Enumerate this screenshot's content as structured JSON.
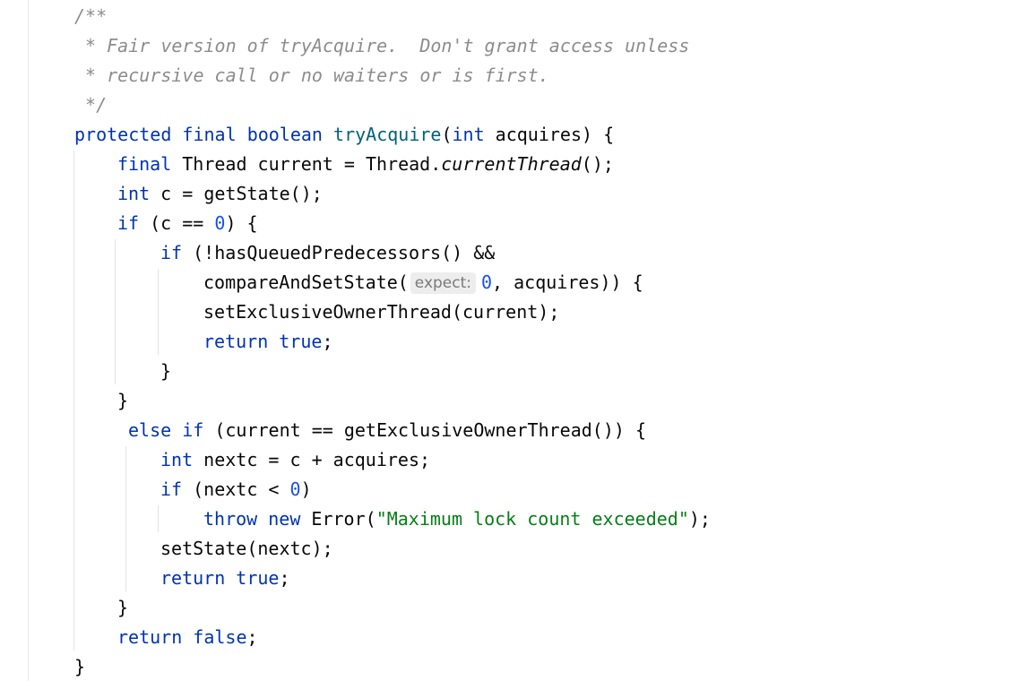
{
  "editor": {
    "language": "java",
    "lines": [
      {
        "tokens": [
          {
            "t": "/**",
            "c": "comment"
          }
        ]
      },
      {
        "tokens": [
          {
            "t": " * Fair version of tryAcquire.  Don't grant access unless",
            "c": "comment"
          }
        ]
      },
      {
        "tokens": [
          {
            "t": " * recursive call or no waiters or is first.",
            "c": "comment"
          }
        ]
      },
      {
        "tokens": [
          {
            "t": " */",
            "c": "comment"
          }
        ]
      },
      {
        "tokens": [
          {
            "t": "protected",
            "c": "keyword"
          },
          {
            "t": " "
          },
          {
            "t": "final",
            "c": "keyword"
          },
          {
            "t": " "
          },
          {
            "t": "boolean",
            "c": "keyword"
          },
          {
            "t": " "
          },
          {
            "t": "tryAcquire",
            "c": "method"
          },
          {
            "t": "("
          },
          {
            "t": "int",
            "c": "keyword"
          },
          {
            "t": " acquires) {"
          }
        ]
      },
      {
        "tokens": [
          {
            "t": "final",
            "c": "keyword"
          },
          {
            "t": " Thread current = Thread."
          },
          {
            "t": "currentThread",
            "c": "italic"
          },
          {
            "t": "();"
          }
        ]
      },
      {
        "tokens": [
          {
            "t": "int",
            "c": "keyword"
          },
          {
            "t": " c = getState();"
          }
        ]
      },
      {
        "tokens": [
          {
            "t": "if",
            "c": "keyword"
          },
          {
            "t": " (c == "
          },
          {
            "t": "0",
            "c": "number"
          },
          {
            "t": ") {"
          }
        ]
      },
      {
        "tokens": [
          {
            "t": "if",
            "c": "keyword"
          },
          {
            "t": " (!hasQueuedPredecessors() &&"
          }
        ]
      },
      {
        "tokens": [
          {
            "t": "compareAndSetState("
          },
          {
            "t": "expect:",
            "c": "hint"
          },
          {
            "t": "0",
            "c": "number"
          },
          {
            "t": ", acquires)) {"
          }
        ]
      },
      {
        "tokens": [
          {
            "t": "setExclusiveOwnerThread(current);"
          }
        ]
      },
      {
        "tokens": [
          {
            "t": "return",
            "c": "keyword"
          },
          {
            "t": " "
          },
          {
            "t": "true",
            "c": "keyword"
          },
          {
            "t": ";"
          }
        ]
      },
      {
        "tokens": [
          {
            "t": "}"
          }
        ]
      },
      {
        "tokens": [
          {
            "t": "}"
          }
        ]
      },
      {
        "tokens": [
          {
            "t": "else",
            "c": "keyword"
          },
          {
            "t": " "
          },
          {
            "t": "if",
            "c": "keyword"
          },
          {
            "t": " (current == getExclusiveOwnerThread()) {"
          }
        ]
      },
      {
        "tokens": [
          {
            "t": "int",
            "c": "keyword"
          },
          {
            "t": " nextc = c + acquires;"
          }
        ]
      },
      {
        "tokens": [
          {
            "t": "if",
            "c": "keyword"
          },
          {
            "t": " (nextc < "
          },
          {
            "t": "0",
            "c": "number"
          },
          {
            "t": ")"
          }
        ]
      },
      {
        "tokens": [
          {
            "t": "throw",
            "c": "keyword"
          },
          {
            "t": " "
          },
          {
            "t": "new",
            "c": "keyword"
          },
          {
            "t": " Error("
          },
          {
            "t": "\"Maximum lock count exceeded\"",
            "c": "string"
          },
          {
            "t": ");"
          }
        ]
      },
      {
        "tokens": [
          {
            "t": "setState(nextc);"
          }
        ]
      },
      {
        "tokens": [
          {
            "t": "return",
            "c": "keyword"
          },
          {
            "t": " "
          },
          {
            "t": "true",
            "c": "keyword"
          },
          {
            "t": ";"
          }
        ]
      },
      {
        "tokens": [
          {
            "t": "}"
          }
        ]
      },
      {
        "tokens": [
          {
            "t": "return",
            "c": "keyword"
          },
          {
            "t": " "
          },
          {
            "t": "false",
            "c": "keyword"
          },
          {
            "t": ";"
          }
        ]
      },
      {
        "tokens": [
          {
            "t": "}"
          }
        ]
      }
    ]
  }
}
